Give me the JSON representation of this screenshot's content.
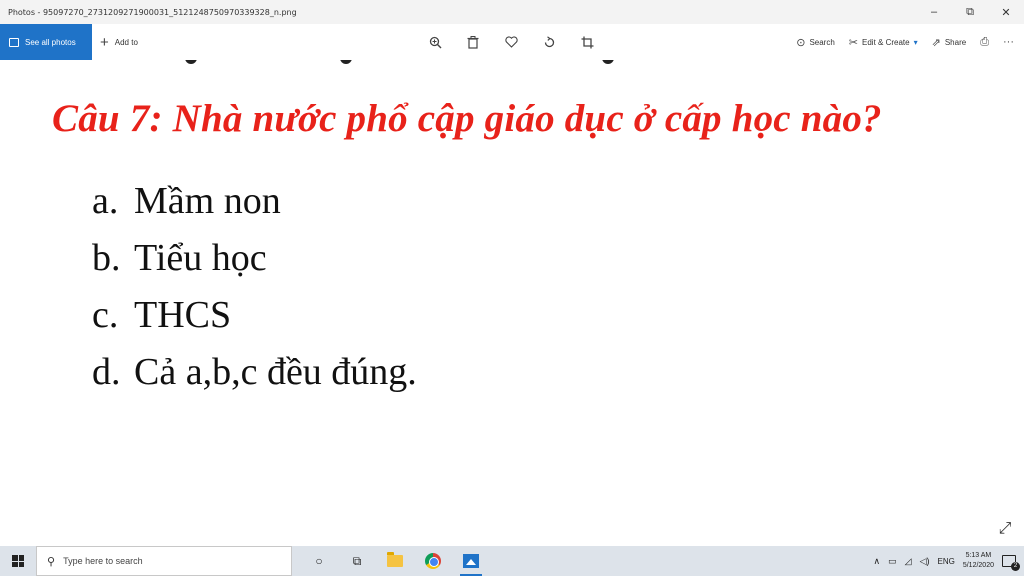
{
  "window": {
    "title": "Photos - 95097270_2731209271900031_5121248750970339328_n.png",
    "minimize_glyph": "–",
    "restore_glyph": "⧉",
    "close_glyph": "✕"
  },
  "toolbar": {
    "see_all_label": "See all photos",
    "add_to_label": "Add to",
    "search_label": "Search",
    "edit_create_label": "Edit & Create",
    "share_label": "Share",
    "more_glyph": "···"
  },
  "image": {
    "question": "Câu 7: Nhà nước phổ cập giáo dục ở cấp học nào?",
    "answers": [
      {
        "key": "a.",
        "text": "Mầm non"
      },
      {
        "key": "b.",
        "text": "Tiểu học"
      },
      {
        "key": "c.",
        "text": "THCS"
      },
      {
        "key": "d.",
        "text": "Cả a,b,c đều đúng."
      }
    ],
    "question_color": "#e8221a"
  },
  "taskbar": {
    "search_placeholder": "Type here to search",
    "language": "ENG",
    "time": "5:13 AM",
    "date": "5/12/2020",
    "notification_count": "2"
  },
  "colors": {
    "accent": "#1f73c8",
    "taskbar_bg": "#dde3ea"
  }
}
